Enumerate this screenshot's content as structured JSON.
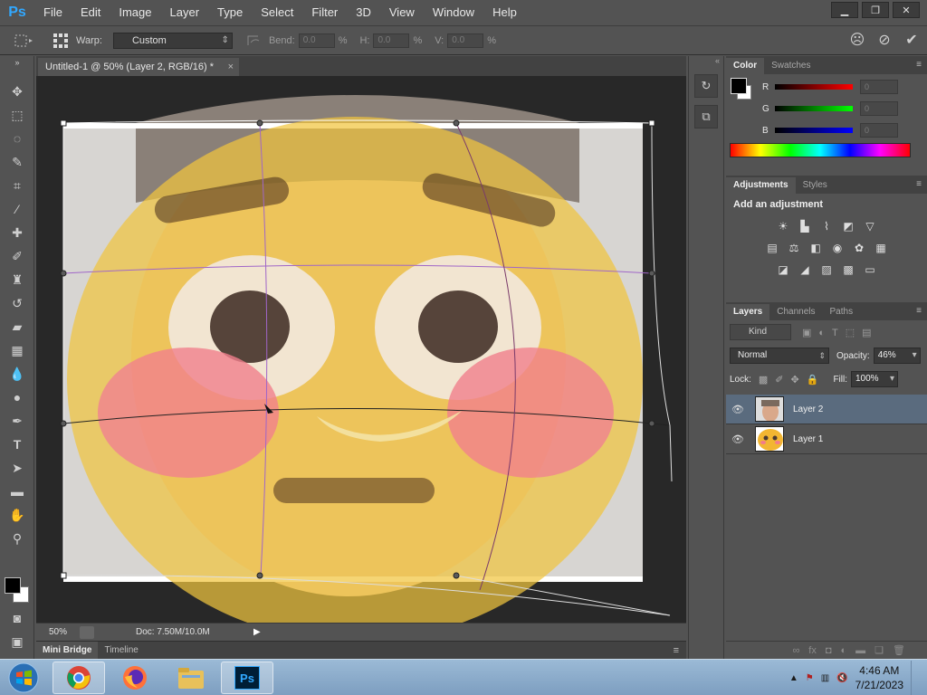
{
  "menubar": {
    "logo": "Ps",
    "items": [
      "File",
      "Edit",
      "Image",
      "Layer",
      "Type",
      "Select",
      "Filter",
      "3D",
      "View",
      "Window",
      "Help"
    ]
  },
  "options": {
    "warp_label": "Warp:",
    "warp_value": "Custom",
    "bend_label": "Bend:",
    "bend_value": "0.0",
    "h_label": "H:",
    "h_value": "0.0",
    "v_label": "V:",
    "v_value": "0.0",
    "pct": "%"
  },
  "document": {
    "tab_title": "Untitled-1 @ 50% (Layer 2, RGB/16) *",
    "zoom": "50%",
    "doc_info": "Doc: 7.50M/10.0M"
  },
  "bottom_tabs": [
    "Mini Bridge",
    "Timeline"
  ],
  "color_panel": {
    "tabs": [
      "Color",
      "Swatches"
    ],
    "channels": [
      {
        "label": "R",
        "value": "0"
      },
      {
        "label": "G",
        "value": "0"
      },
      {
        "label": "B",
        "value": "0"
      }
    ]
  },
  "adjustments_panel": {
    "tabs": [
      "Adjustments",
      "Styles"
    ],
    "title": "Add an adjustment"
  },
  "layers_panel": {
    "tabs": [
      "Layers",
      "Channels",
      "Paths"
    ],
    "kind_label": "Kind",
    "blend_mode": "Normal",
    "opacity_label": "Opacity:",
    "opacity_value": "46%",
    "lock_label": "Lock:",
    "fill_label": "Fill:",
    "fill_value": "100%",
    "layers": [
      {
        "name": "Layer 2",
        "selected": true
      },
      {
        "name": "Layer 1",
        "selected": false
      }
    ]
  },
  "taskbar": {
    "time": "4:46 AM",
    "date": "7/21/2023",
    "ps_label": "Ps"
  }
}
